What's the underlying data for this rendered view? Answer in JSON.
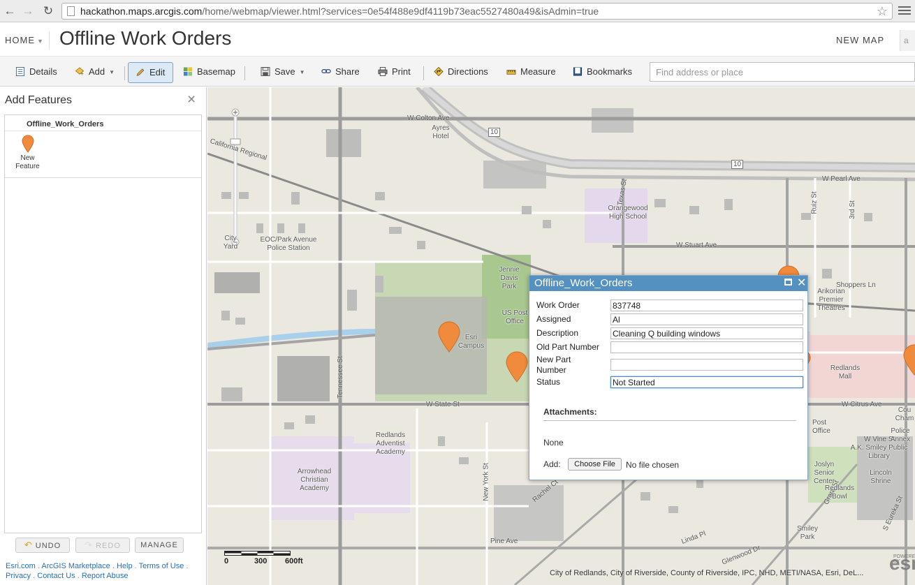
{
  "browser": {
    "url_host": "hackathon.maps.arcgis.com",
    "url_rest": "/home/webmap/viewer.html?services=0e54f488e9df4119b73eac5527480a49&isAdmin=true",
    "back_icon": "arrow-left-icon",
    "forward_icon": "arrow-right-icon",
    "reload_icon": "reload-icon"
  },
  "header": {
    "home_label": "HOME",
    "title": "Offline Work Orders",
    "new_map_label": "NEW MAP"
  },
  "toolbar": {
    "details": "Details",
    "add": "Add",
    "edit": "Edit",
    "basemap": "Basemap",
    "save": "Save",
    "share": "Share",
    "print": "Print",
    "directions": "Directions",
    "measure": "Measure",
    "bookmarks": "Bookmarks",
    "search_placeholder": "Find address or place"
  },
  "side_panel": {
    "title": "Add Features",
    "layer_name": "Offline_Work_Orders",
    "template_label_1": "New",
    "template_label_2": "Feature",
    "undo": "UNDO",
    "redo": "REDO",
    "manage": "MANAGE",
    "footer_links": [
      "Esri.com",
      "ArcGIS Marketplace",
      "Help",
      "Terms of Use",
      "Privacy",
      "Contact Us",
      "Report Abuse"
    ]
  },
  "map": {
    "streets": {
      "colton": "W Colton Ave",
      "pearl": "W Pearl Ave",
      "stuart": "W Stuart Ave",
      "state": "W State St",
      "citrus": "W Citrus Ave",
      "vine": "W Vine St",
      "pine": "Pine Ave",
      "linda": "Linda Pl",
      "glenwood": "Glenwood Dr",
      "rachel": "Rachel Ct",
      "tennessee": "Tennessee St",
      "texas": "Texas St",
      "newyork": "New York St",
      "ruiz": "Ruiz St",
      "third": "3rd St",
      "grant": "Grant St",
      "eureka": "S Eureka St",
      "california": "California Regional",
      "shoppers": "Shoppers Ln",
      "i10": "10"
    },
    "places": {
      "ayres": "Ayres Hotel",
      "orangewood": "Orangewood High School",
      "eoc": "EOC/Park Avenue Police Station",
      "city_yard": "City Yard",
      "jennie_davis": "Jennie Davis Park",
      "us_post": "US Post Office",
      "esri": "Esri Campus",
      "arikorian": "Arikorian Premier Theatres",
      "redlands_mall": "Redlands Mall",
      "adventist": "Redlands Adventist Academy",
      "arrowhead": "Arrowhead Christian Academy",
      "post_office": "Post Office",
      "smiley_library": "A.K. Smiley Public Library",
      "police_annex": "Police Annex",
      "joslyn": "Joslyn Senior Center",
      "lincoln": "Lincoln Shrine",
      "redlands_bowl": "Redlands Bowl",
      "smiley_park": "Smiley Park",
      "chamber": "Cou Cham"
    },
    "scale": {
      "zero": "0",
      "mid": "300",
      "end": "600ft"
    },
    "attribution": "City of Redlands, City of Riverside, County of Riverside, IPC, NHD, METI/NASA, Esri, DeL...",
    "logo": "esri",
    "logo_caption": "POWERED BY"
  },
  "popup": {
    "title": "Offline_Work_Orders",
    "fields": [
      {
        "label": "Work Order",
        "value": "837748"
      },
      {
        "label": "Assigned",
        "value": "Al"
      },
      {
        "label": "Description",
        "value": "Cleaning Q building windows"
      },
      {
        "label": "Old Part Number",
        "value": ""
      },
      {
        "label": "New Part",
        "label2": "Number",
        "value": ""
      },
      {
        "label": "Status",
        "value": "Not Started"
      }
    ],
    "attachments_title": "Attachments:",
    "attachments_none": "None",
    "add_label": "Add:",
    "choose_file": "Choose File",
    "no_file": "No file chosen"
  },
  "colors": {
    "marker": "#f08a3c",
    "popup_header": "#5490c0",
    "edit_active": "#dceaf7",
    "link": "#2a6fb0"
  }
}
